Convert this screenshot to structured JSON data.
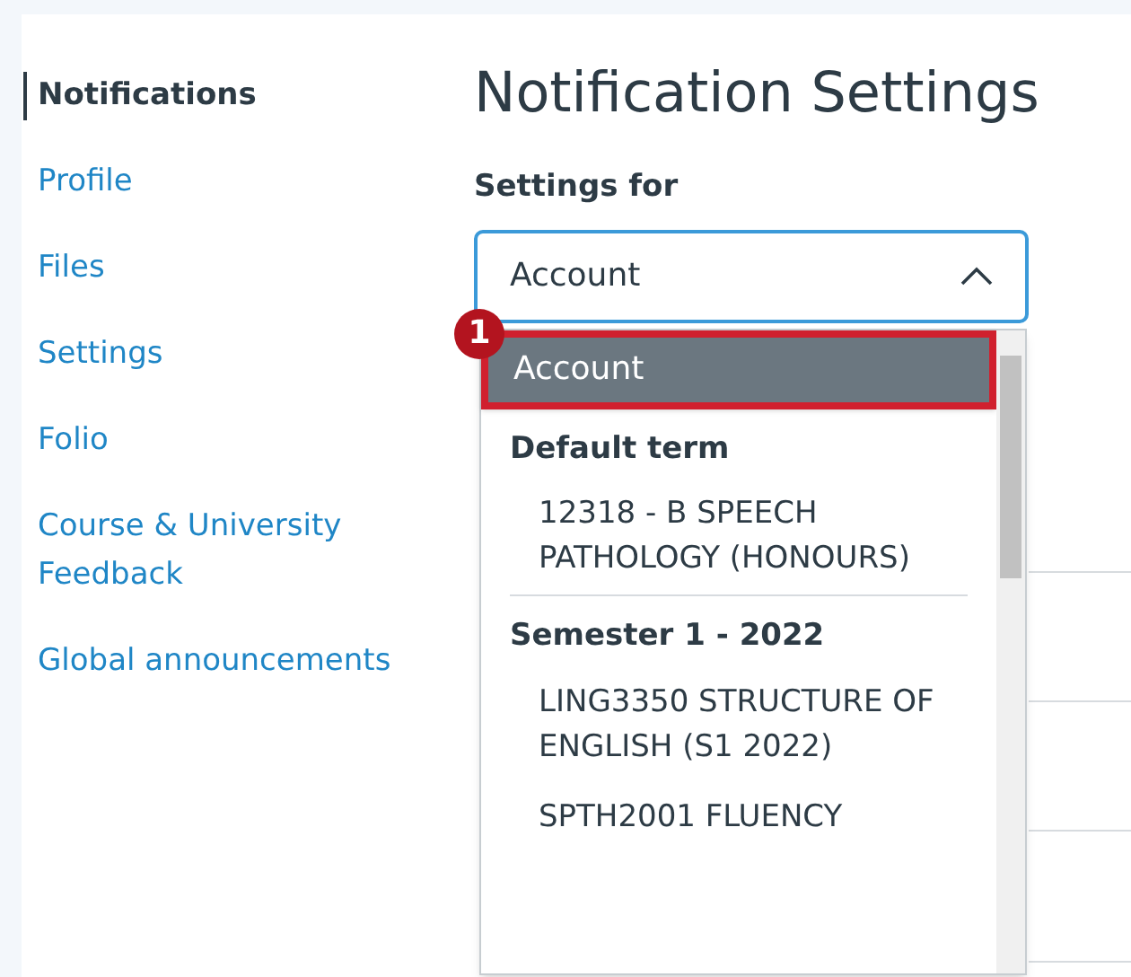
{
  "sidebar": {
    "items": [
      {
        "label": "Notifications",
        "selected": true
      },
      {
        "label": "Profile",
        "selected": false
      },
      {
        "label": "Files",
        "selected": false
      },
      {
        "label": "Settings",
        "selected": false
      },
      {
        "label": "Folio",
        "selected": false
      },
      {
        "label": "Course & University Feedback",
        "selected": false
      },
      {
        "label": "Global announcements",
        "selected": false
      }
    ]
  },
  "page_title": "Notification Settings",
  "settings_for": {
    "label": "Settings for",
    "value": "Account",
    "expanded": true,
    "options": [
      {
        "kind": "option",
        "label": "Account",
        "selected": true
      },
      {
        "kind": "group",
        "label": "Default term"
      },
      {
        "kind": "option",
        "label": "12318 - B SPEECH PATHOLOGY (HONOURS)",
        "selected": false
      },
      {
        "kind": "group",
        "label": "Semester 1 - 2022"
      },
      {
        "kind": "option",
        "label": "LING3350 STRUCTURE OF ENGLISH (S1 2022)",
        "selected": false
      },
      {
        "kind": "option",
        "label": "SPTH2001 FLUENCY",
        "selected": false
      }
    ]
  },
  "annotation": {
    "number": "1"
  }
}
